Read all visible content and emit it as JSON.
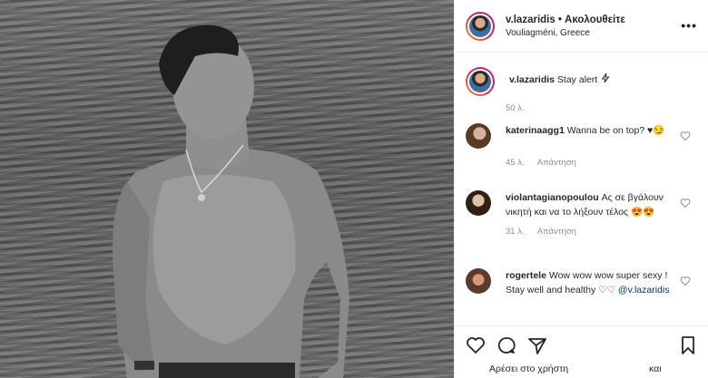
{
  "header": {
    "username": "v.lazaridis",
    "follow_status": "• Ακολουθείτε",
    "location": "Vouliagméni, Greece",
    "more_icon": "more-dots-icon"
  },
  "caption": {
    "username": "v.lazaridis",
    "text": "Stay alert",
    "time": "50 λ."
  },
  "comments": [
    {
      "username": "katerinaagg1",
      "text": "Wanna be on top? ♥😏",
      "time": "45 λ.",
      "reply": "Απάντηση"
    },
    {
      "username": "violantagianopoulou",
      "text": "Ας σε βγάλουν νικητή και να το λήξουν τέλος 😍😍",
      "time": "31 λ.",
      "reply": "Απάντηση"
    },
    {
      "username": "rogertele",
      "text": "Wow wow wow super sexy ! Stay well and healthy ♡♡",
      "mention": "@v.lazaridis"
    }
  ],
  "actions": {
    "liked_by": "Αρέσει στο χρήστη",
    "and": "και"
  },
  "colors": {
    "ring_start": "#f09433",
    "ring_end": "#bc1888",
    "mention": "#00376b",
    "muted": "#8e8e8e"
  }
}
